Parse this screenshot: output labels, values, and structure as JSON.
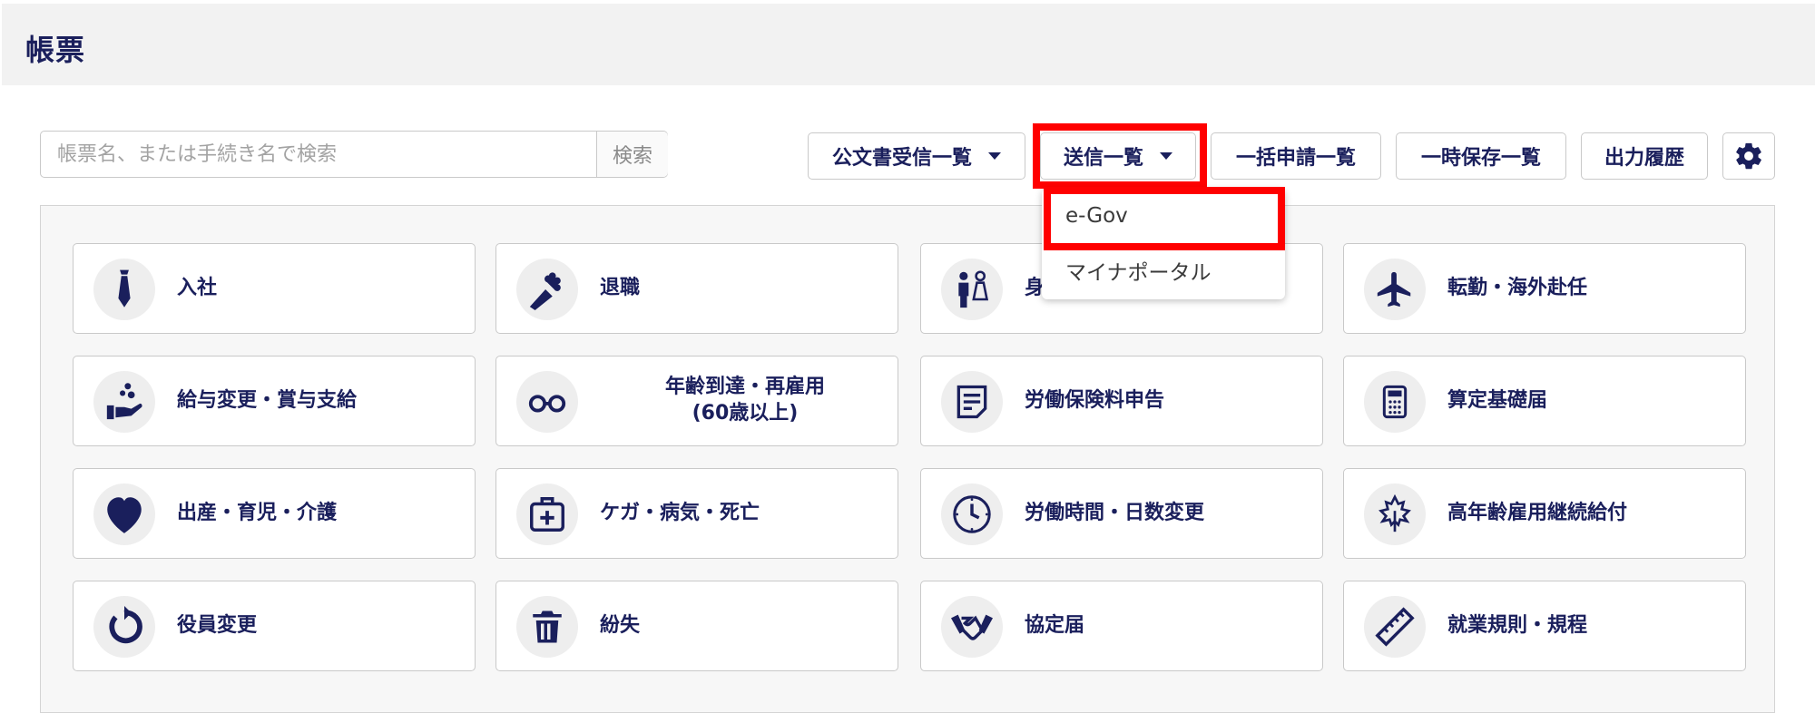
{
  "header": {
    "title": "帳票"
  },
  "search": {
    "placeholder": "帳票名、または手続き名で検索",
    "value": "",
    "button_label": "検索"
  },
  "toolbar": {
    "received_docs": "公文書受信一覧",
    "sent_list": "送信一覧",
    "batch_list": "一括申請一覧",
    "temp_saved": "一時保存一覧",
    "output_history": "出力履歴",
    "settings_icon": "gear-icon"
  },
  "dropdown": {
    "items": [
      "e-Gov",
      "マイナポータル"
    ]
  },
  "highlight_color": "#ff0000",
  "accent_color": "#1a1f5c",
  "cards": [
    {
      "label": "入社",
      "icon": "tie-icon"
    },
    {
      "label": "退職",
      "icon": "bouquet-icon"
    },
    {
      "label": "身",
      "icon": "couple-icon"
    },
    {
      "label": "転勤・海外赴任",
      "icon": "airplane-icon"
    },
    {
      "label": "給与変更・賞与支給",
      "icon": "hand-coins-icon"
    },
    {
      "label": "年齢到達・再雇用",
      "label2": "(60歳以上)",
      "icon": "glasses-icon"
    },
    {
      "label": "労働保険料申告",
      "icon": "document-icon"
    },
    {
      "label": "算定基礎届",
      "icon": "calculator-icon"
    },
    {
      "label": "出産・育児・介護",
      "icon": "heart-icon"
    },
    {
      "label": "ケガ・病気・死亡",
      "icon": "first-aid-icon"
    },
    {
      "label": "労働時間・日数変更",
      "icon": "clock-icon"
    },
    {
      "label": "高年齢雇用継続給付",
      "icon": "maple-leaf-icon"
    },
    {
      "label": "役員変更",
      "icon": "refresh-icon"
    },
    {
      "label": "紛失",
      "icon": "trash-icon"
    },
    {
      "label": "協定届",
      "icon": "handshake-icon"
    },
    {
      "label": "就業規則・規程",
      "icon": "ruler-icon"
    }
  ]
}
